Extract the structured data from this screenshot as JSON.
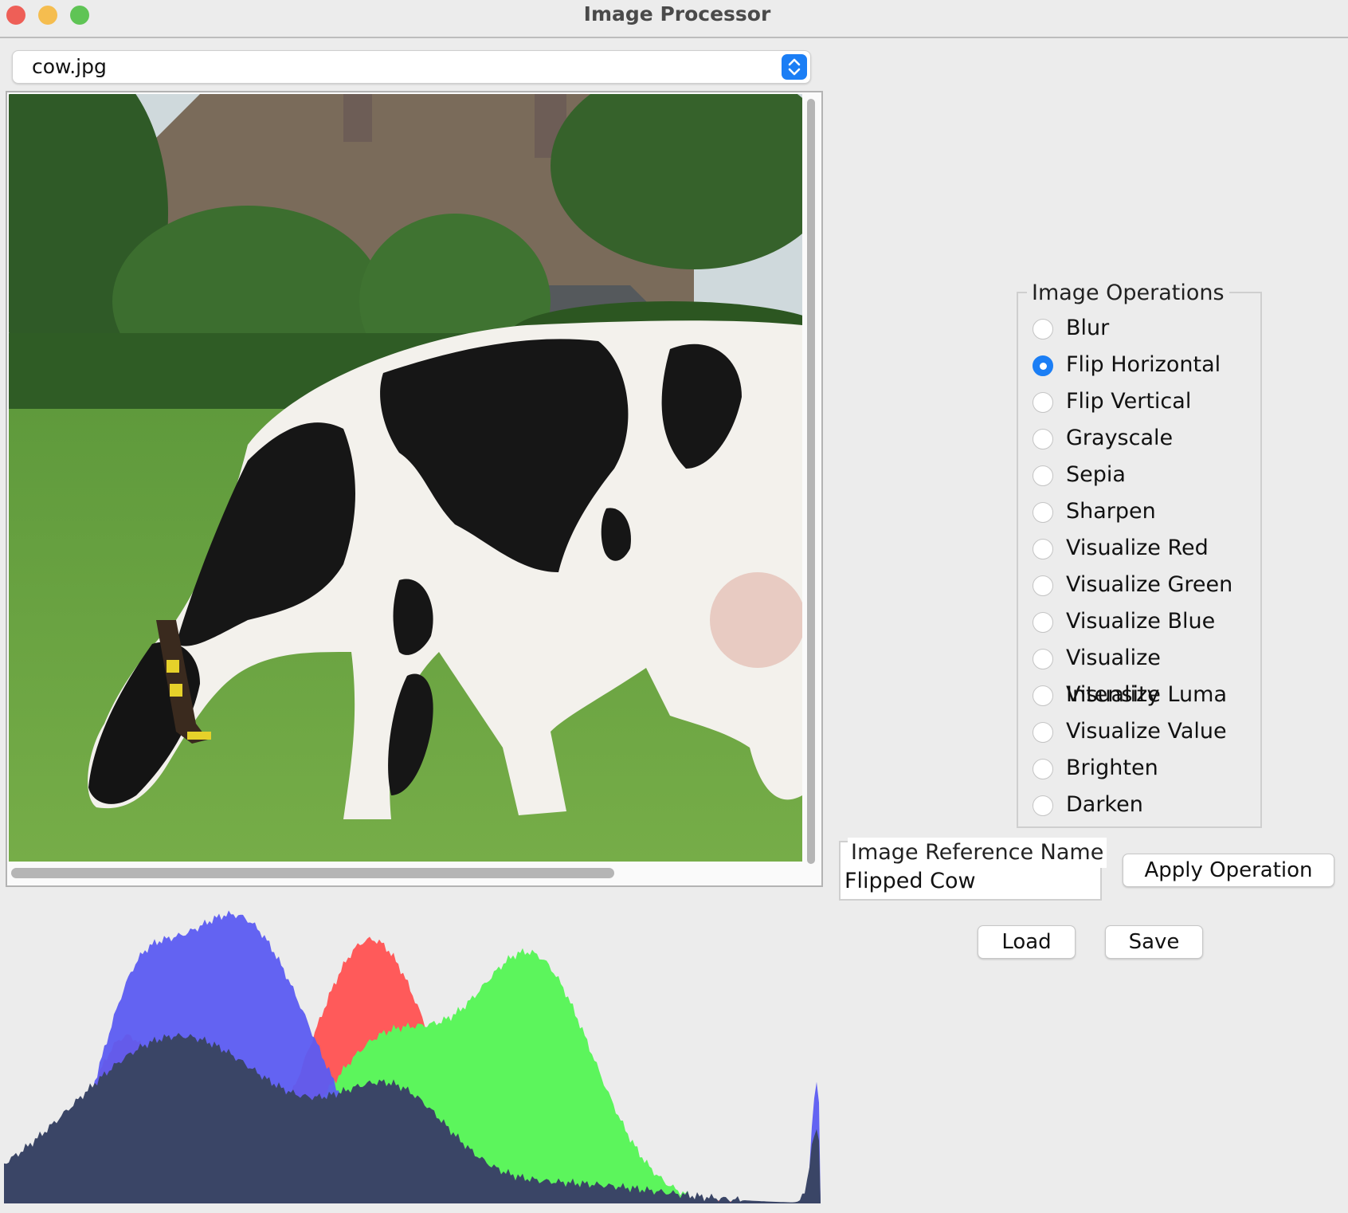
{
  "window": {
    "title": "Image Processor",
    "traffic_lights": [
      {
        "name": "close",
        "color": "#ee5f57"
      },
      {
        "name": "minimize",
        "color": "#f5bd4f"
      },
      {
        "name": "zoom",
        "color": "#5fc455"
      }
    ]
  },
  "image_select": {
    "value": "cow.jpg"
  },
  "operations": {
    "title": "Image Operations",
    "selected": "Flip Horizontal",
    "items": [
      "Blur",
      "Flip Horizontal",
      "Flip Vertical",
      "Grayscale",
      "Sepia",
      "Sharpen",
      "Visualize Red",
      "Visualize Green",
      "Visualize Blue",
      "Visualize Intensity",
      "Visualize Luma",
      "Visualize Value",
      "Brighten",
      "Darken"
    ]
  },
  "reference": {
    "label": "Image Reference Name",
    "value": "Flipped Cow"
  },
  "buttons": {
    "apply": "Apply Operation",
    "load": "Load",
    "save": "Save"
  },
  "histogram": {
    "series_colors": {
      "red": "#ff5a5a",
      "green": "#5cf55c",
      "blue": "#5c5cf2",
      "intensity": "#3a4566"
    }
  }
}
